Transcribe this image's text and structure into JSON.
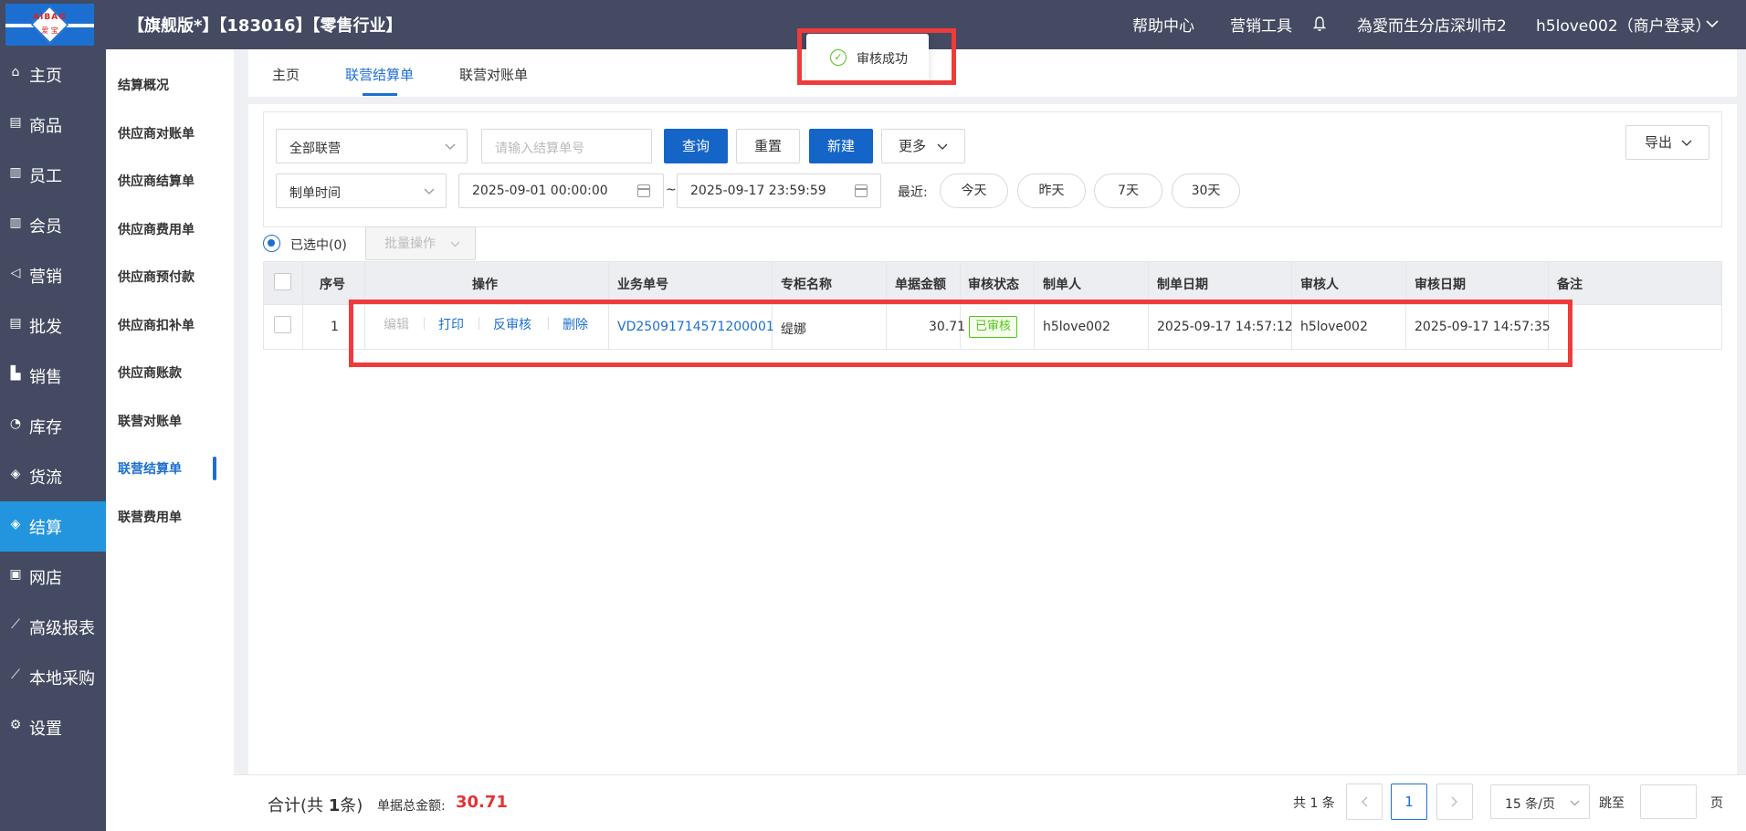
{
  "brand": {
    "logo_text": "AIBAO",
    "logo_sub": "爱 宝"
  },
  "header": {
    "title": "【旗舰版*】【183016】【零售行业】",
    "help": "帮助中心",
    "marketing": "营销工具",
    "store": "為愛而生分店深圳市2",
    "user": "h5love002（商户登录）"
  },
  "toast": {
    "text": "审核成功"
  },
  "sidebar": {
    "items": [
      {
        "label": "主页",
        "icon": "home-icon"
      },
      {
        "label": "商品",
        "icon": "goods-icon"
      },
      {
        "label": "员工",
        "icon": "staff-icon"
      },
      {
        "label": "会员",
        "icon": "member-icon"
      },
      {
        "label": "营销",
        "icon": "megaphone-icon"
      },
      {
        "label": "批发",
        "icon": "wholesale-icon"
      },
      {
        "label": "销售",
        "icon": "chart-icon"
      },
      {
        "label": "库存",
        "icon": "stock-icon"
      },
      {
        "label": "货流",
        "icon": "logistics-icon"
      },
      {
        "label": "结算",
        "icon": "settle-icon"
      },
      {
        "label": "网店",
        "icon": "shop-icon"
      },
      {
        "label": "高级报表",
        "icon": "report-icon"
      },
      {
        "label": "本地采购",
        "icon": "purchase-icon"
      },
      {
        "label": "设置",
        "icon": "gear-icon"
      }
    ],
    "active": "结算"
  },
  "subnav": {
    "items": [
      "结算概况",
      "供应商对账单",
      "供应商结算单",
      "供应商费用单",
      "供应商预付款",
      "供应商扣补单",
      "供应商账款",
      "联营对账单",
      "联营结算单",
      "联营费用单"
    ],
    "active": "联营结算单"
  },
  "tabs": [
    "主页",
    "联营结算单",
    "联营对账单"
  ],
  "filters": {
    "type_select": "全部联营",
    "order_no_placeholder": "请输入结算单号",
    "query": "查询",
    "reset": "重置",
    "new": "新建",
    "more": "更多",
    "export": "导出",
    "time_select": "制单时间",
    "start": "2025-09-01 00:00:00",
    "tilde": "~",
    "end": "2025-09-17 23:59:59",
    "recent_label": "最近:",
    "quick": [
      "今天",
      "昨天",
      "7天",
      "30天"
    ]
  },
  "selection": {
    "label": "已选中(0)",
    "batch": "批量操作"
  },
  "table": {
    "headers": [
      "序号",
      "操作",
      "业务单号",
      "专柜名称",
      "单据金额",
      "审核状态",
      "制单人",
      "制单日期",
      "审核人",
      "审核日期",
      "备注"
    ],
    "rows": [
      {
        "index": "1",
        "ops": [
          "编辑",
          "打印",
          "反审核",
          "删除"
        ],
        "order_no": "VD25091714571200001",
        "counter": "缇娜",
        "amount": "30.71",
        "status": "已审核",
        "creator": "h5love002",
        "created": "2025-09-17 14:57:12",
        "auditor": "h5love002",
        "audited": "2025-09-17 14:57:35",
        "remark": ""
      }
    ]
  },
  "footer": {
    "total_prefix": "合计(共 ",
    "total_count": "1",
    "total_suffix": "条)",
    "amount_label": "单据总金额:",
    "amount_value": "30.71",
    "records": "共 1 条",
    "page": "1",
    "page_size": "15 条/页",
    "jump": "跳至",
    "page_unit": "页"
  },
  "colors": {
    "accent": "#1c6fd0",
    "sidebar": "#434a61",
    "active_nav": "#2395de",
    "highlight": "#ef3b3b",
    "success": "#52c41a"
  }
}
